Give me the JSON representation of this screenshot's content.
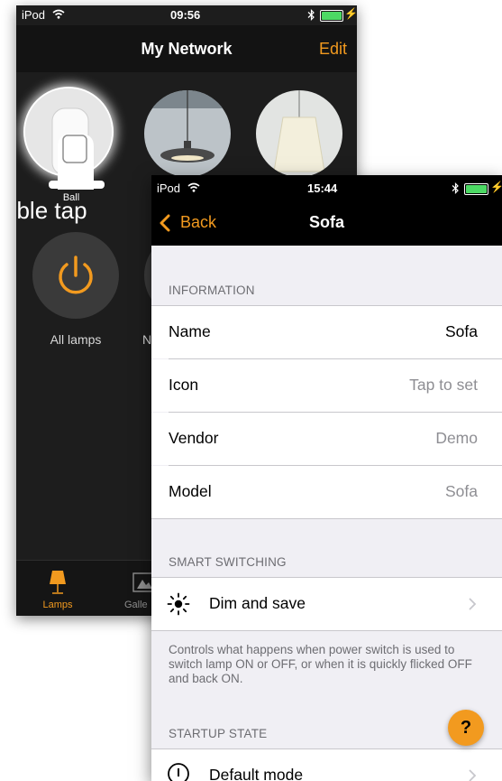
{
  "back_screen": {
    "status": {
      "carrier": "iPod",
      "time": "09:56"
    },
    "nav": {
      "title": "My Network",
      "edit_label": "Edit"
    },
    "lamps": [
      {
        "label": "Ball"
      }
    ],
    "hint_text": "uble tap",
    "all_lamps_label": "All lamps",
    "partial_label": "N",
    "tabs": {
      "lamps": "Lamps",
      "gallery": "Galle"
    },
    "accent_color": "#f29a1f"
  },
  "front_screen": {
    "status": {
      "carrier": "iPod",
      "time": "15:44"
    },
    "nav": {
      "back_label": "Back",
      "title": "Sofa"
    },
    "information": {
      "header": "INFORMATION",
      "rows": [
        {
          "label": "Name",
          "value": "Sofa"
        },
        {
          "label": "Icon",
          "value": "Tap to set"
        },
        {
          "label": "Vendor",
          "value": "Demo"
        },
        {
          "label": "Model",
          "value": "Sofa"
        }
      ]
    },
    "smart_switching": {
      "header": "SMART SWITCHING",
      "item_label": "Dim and save",
      "footer": "Controls what happens when power switch is used to switch lamp ON or OFF, or when it is quickly flicked OFF and back ON."
    },
    "startup_state": {
      "header": "STARTUP STATE",
      "item_label": "Default mode"
    },
    "help_label": "?",
    "accent_color": "#f29a1f"
  }
}
